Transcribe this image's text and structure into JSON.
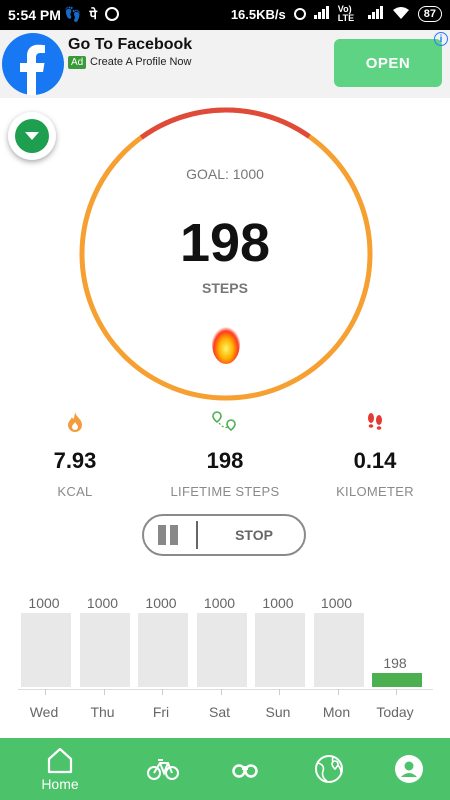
{
  "status_bar": {
    "time": "5:54 PM",
    "speed": "16.5KB/s",
    "network": "Vo) LTE",
    "battery": "87"
  },
  "ad": {
    "title": "Go To Facebook",
    "badge": "Ad",
    "subtitle": "Create A Profile Now",
    "open_label": "OPEN",
    "info_label": "i"
  },
  "tracker": {
    "goal_text": "GOAL: 1000",
    "steps": "198",
    "steps_label": "STEPS",
    "goal": 1000,
    "progress_fraction": 0.198
  },
  "stats": [
    {
      "value": "7.93",
      "label": "KCAL",
      "icon": "flame-icon",
      "icon_color": "#f39c3d"
    },
    {
      "value": "198",
      "label": "LIFETIME STEPS",
      "icon": "location-pins-icon",
      "icon_color": "#4caf50"
    },
    {
      "value": "0.14",
      "label": "KILOMETER",
      "icon": "footprints-icon",
      "icon_color": "#e53935"
    }
  ],
  "controls": {
    "stop_label": "STOP"
  },
  "week_chart": {
    "max": 1000,
    "days": [
      {
        "day": "Wed",
        "value": 1000,
        "label": "1000",
        "today": false
      },
      {
        "day": "Thu",
        "value": 1000,
        "label": "1000",
        "today": false
      },
      {
        "day": "Fri",
        "value": 1000,
        "label": "1000",
        "today": false
      },
      {
        "day": "Sat",
        "value": 1000,
        "label": "1000",
        "today": false
      },
      {
        "day": "Sun",
        "value": 1000,
        "label": "1000",
        "today": false
      },
      {
        "day": "Mon",
        "value": 1000,
        "label": "1000",
        "today": false
      },
      {
        "day": "Today",
        "value": 198,
        "label": "198",
        "today": true
      }
    ]
  },
  "nav": {
    "home_label": "Home"
  },
  "colors": {
    "ring_orange": "#f5a031",
    "ring_red": "#e04a3a",
    "accent_green": "#4cc36a",
    "today_bar": "#4caf50"
  }
}
